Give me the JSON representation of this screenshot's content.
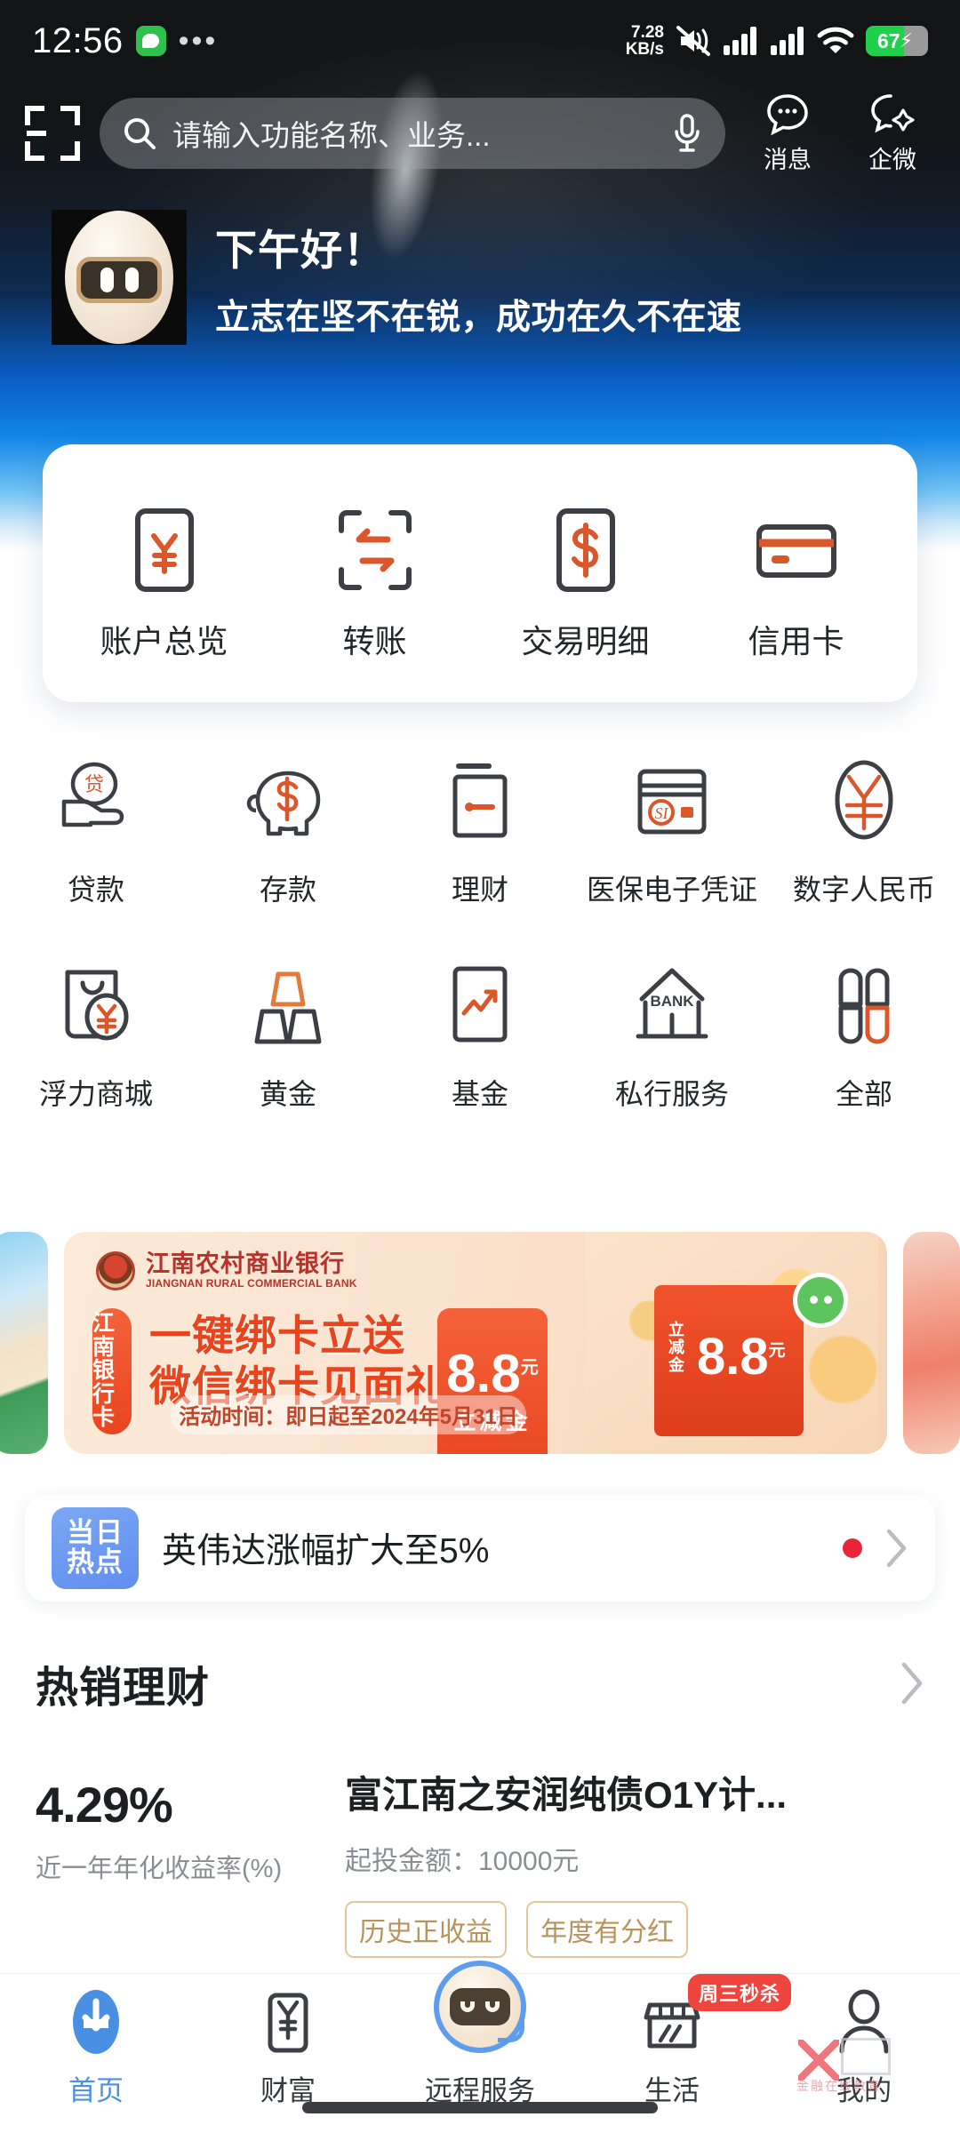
{
  "status_bar": {
    "time": "12:56",
    "net_speed_value": "7.28",
    "net_speed_unit": "KB/s",
    "battery_percent": "67",
    "battery_charging": true,
    "icons": [
      "wechat-icon",
      "more-dots-icon",
      "mute-icon",
      "signal-icon",
      "signal-icon",
      "wifi-icon",
      "battery-icon"
    ]
  },
  "header": {
    "scan_icon": "scan-icon",
    "search_placeholder": "请输入功能名称、业务...",
    "search_icon": "search-icon",
    "mic_icon": "microphone-icon",
    "actions": [
      {
        "label": "消息",
        "icon": "message-bubble-icon"
      },
      {
        "label": "企微",
        "icon": "enterprise-wechat-icon"
      }
    ]
  },
  "greeting": {
    "avatar": "robot-avatar",
    "line1": "下午好！",
    "line2": "立志在坚不在锐，成功在久不在速"
  },
  "quick_actions": [
    {
      "label": "账户总览",
      "icon": "yuan-card-icon"
    },
    {
      "label": "转账",
      "icon": "transfer-arrows-icon"
    },
    {
      "label": "交易明细",
      "icon": "dollar-card-icon"
    },
    {
      "label": "信用卡",
      "icon": "credit-card-icon"
    }
  ],
  "grid": [
    {
      "label": "贷款",
      "icon": "loan-hand-icon"
    },
    {
      "label": "存款",
      "icon": "piggy-bank-icon"
    },
    {
      "label": "理财",
      "icon": "wealth-door-icon"
    },
    {
      "label": "医保电子凭证",
      "icon": "medical-insurance-card-icon"
    },
    {
      "label": "数字人民币",
      "icon": "digital-rmb-icon"
    },
    {
      "label": "浮力商城",
      "icon": "shopping-bag-icon"
    },
    {
      "label": "黄金",
      "icon": "gold-bars-icon"
    },
    {
      "label": "基金",
      "icon": "fund-chart-icon"
    },
    {
      "label": "私行服务",
      "icon": "bank-building-icon"
    },
    {
      "label": "全部",
      "icon": "all-clover-icon"
    }
  ],
  "banner": {
    "bank_name_cn": "江南农村商业银行",
    "bank_name_en": "JIANGNAN RURAL COMMERCIAL BANK",
    "vertical_tag": "江南银行卡",
    "slogan_line1": "一键绑卡立送",
    "slogan_line2": "微信绑卡见面礼",
    "amount": "8.8",
    "amount_unit": "元",
    "amount_sub": "立减金",
    "gift_amount": "8.8",
    "gift_amount_unit": "元",
    "gift_side_text": "立减金",
    "period": "活动时间：即日起至2024年5月31日"
  },
  "hot_news": {
    "badge": "当日热点",
    "text": "英伟达涨幅扩大至5%",
    "dot_color": "#e8243a",
    "chevron_icon": "chevron-right-icon"
  },
  "wealth_section": {
    "title": "热销理财",
    "more_icon": "chevron-right-icon",
    "product": {
      "rate": "4.29%",
      "rate_label": "近一年年化收益率(%)",
      "name": "富江南之安润纯债O1Y计...",
      "min_invest": "起投金额：10000元",
      "tags": [
        "历史正收益",
        "年度有分红"
      ]
    }
  },
  "bottom_nav": {
    "items": [
      {
        "label": "首页",
        "icon": "home-icon",
        "active": true
      },
      {
        "label": "财富",
        "icon": "wealth-icon",
        "active": false
      },
      {
        "label": "远程服务",
        "icon": "remote-service-robot-icon",
        "active": false
      },
      {
        "label": "生活",
        "icon": "life-store-icon",
        "active": false,
        "badge": "周三秒杀"
      },
      {
        "label": "我的",
        "icon": "profile-person-icon",
        "active": false
      }
    ]
  },
  "colors": {
    "accent_blue": "#4a90e2",
    "brand_orange": "#e8441d",
    "icon_dark": "#3c3f44",
    "icon_orange": "#d9572b",
    "hot_badge_blue": "#5f8ef0",
    "red_dot": "#e8243a"
  }
}
